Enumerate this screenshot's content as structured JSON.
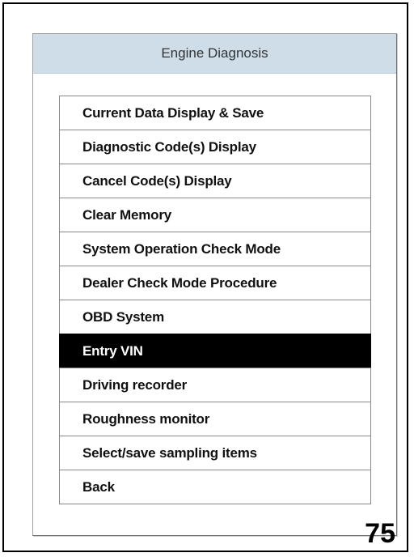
{
  "panel": {
    "title": "Engine Diagnosis"
  },
  "menu": {
    "selected_index": 7,
    "items": [
      {
        "label": "Current Data Display & Save"
      },
      {
        "label": "Diagnostic Code(s) Display"
      },
      {
        "label": "Cancel Code(s) Display"
      },
      {
        "label": "Clear Memory"
      },
      {
        "label": "System Operation Check Mode"
      },
      {
        "label": "Dealer Check Mode Procedure"
      },
      {
        "label": "OBD System"
      },
      {
        "label": "Entry VIN"
      },
      {
        "label": "Driving recorder"
      },
      {
        "label": "Roughness monitor"
      },
      {
        "label": "Select/save sampling items"
      },
      {
        "label": "Back"
      }
    ]
  },
  "page": {
    "number": "75"
  },
  "colors": {
    "header_bg": "#cfdde9",
    "selected_bg": "#000000",
    "selected_text": "#ffffff"
  }
}
